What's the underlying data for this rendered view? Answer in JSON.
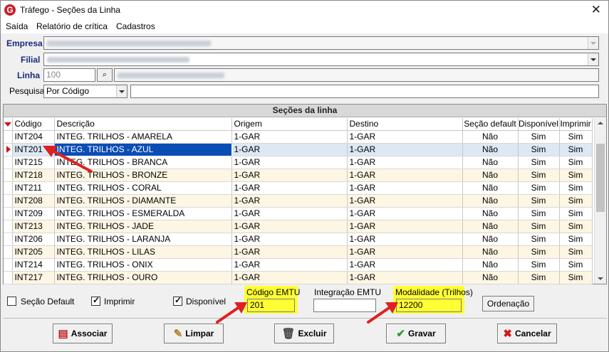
{
  "window": {
    "title": "Tráfego - Seções da Linha"
  },
  "menu": [
    "Saída",
    "Relatório de crítica",
    "Cadastros"
  ],
  "form": {
    "empresa_label": "Empresa",
    "filial_label": "Filial",
    "linha_label": "Linha",
    "linha_value": "100",
    "pesquisa_label": "Pesquisa",
    "pesquisa_mode": "Por Código",
    "pesquisa_value": ""
  },
  "grid": {
    "title": "Seções da linha",
    "columns": [
      "Código",
      "Descrição",
      "Origem",
      "Destino",
      "Seção default",
      "Disponível",
      "Imprimir"
    ],
    "rows": [
      [
        "INT204",
        "INTEG. TRILHOS - AMARELA",
        "1-GAR",
        "1-GAR",
        "Não",
        "Sim",
        "Sim"
      ],
      [
        "INT201",
        "INTEG. TRILHOS - AZUL",
        "1-GAR",
        "1-GAR",
        "Não",
        "Sim",
        "Sim"
      ],
      [
        "INT215",
        "INTEG. TRILHOS - BRANCA",
        "1-GAR",
        "1-GAR",
        "Não",
        "Sim",
        "Sim"
      ],
      [
        "INT218",
        "INTEG. TRILHOS - BRONZE",
        "1-GAR",
        "1-GAR",
        "Não",
        "Sim",
        "Sim"
      ],
      [
        "INT211",
        "INTEG. TRILHOS - CORAL",
        "1-GAR",
        "1-GAR",
        "Não",
        "Sim",
        "Sim"
      ],
      [
        "INT208",
        "INTEG. TRILHOS - DIAMANTE",
        "1-GAR",
        "1-GAR",
        "Não",
        "Sim",
        "Sim"
      ],
      [
        "INT209",
        "INTEG. TRILHOS - ESMERALDA",
        "1-GAR",
        "1-GAR",
        "Não",
        "Sim",
        "Sim"
      ],
      [
        "INT213",
        "INTEG. TRILHOS - JADE",
        "1-GAR",
        "1-GAR",
        "Não",
        "Sim",
        "Sim"
      ],
      [
        "INT206",
        "INTEG. TRILHOS - LARANJA",
        "1-GAR",
        "1-GAR",
        "Não",
        "Sim",
        "Sim"
      ],
      [
        "INT205",
        "INTEG. TRILHOS - LILAS",
        "1-GAR",
        "1-GAR",
        "Não",
        "Sim",
        "Sim"
      ],
      [
        "INT214",
        "INTEG. TRILHOS - ONIX",
        "1-GAR",
        "1-GAR",
        "Não",
        "Sim",
        "Sim"
      ],
      [
        "INT217",
        "INTEG. TRILHOS - OURO",
        "1-GAR",
        "1-GAR",
        "Não",
        "Sim",
        "Sim"
      ]
    ],
    "selected_row_index": 1
  },
  "options": {
    "secao_default_label": "Seção Default",
    "secao_default_checked": false,
    "imprimir_label": "Imprimir",
    "imprimir_checked": true,
    "disponivel_label": "Disponível",
    "disponivel_checked": true,
    "codigo_emtu_label": "Código EMTU",
    "codigo_emtu_value": "201",
    "integracao_emtu_label": "Integração EMTU",
    "integracao_emtu_value": "",
    "modalidade_label": "Modalidade (Trilhos)",
    "modalidade_value": "12200",
    "ordenacao_label": "Ordenação"
  },
  "buttons": {
    "associar": "Associar",
    "limpar": "Limpar",
    "excluir": "Excluir",
    "gravar": "Gravar",
    "cancelar": "Cancelar"
  },
  "colors": {
    "highlight": "#ffff33",
    "arrow": "#e02020",
    "selection": "#0a4db5"
  },
  "icons": [
    "app-logo-icon",
    "close-icon",
    "binoculars-icon",
    "add-record-icon",
    "eraser-icon",
    "trash-icon",
    "check-icon",
    "cancel-x-icon"
  ]
}
